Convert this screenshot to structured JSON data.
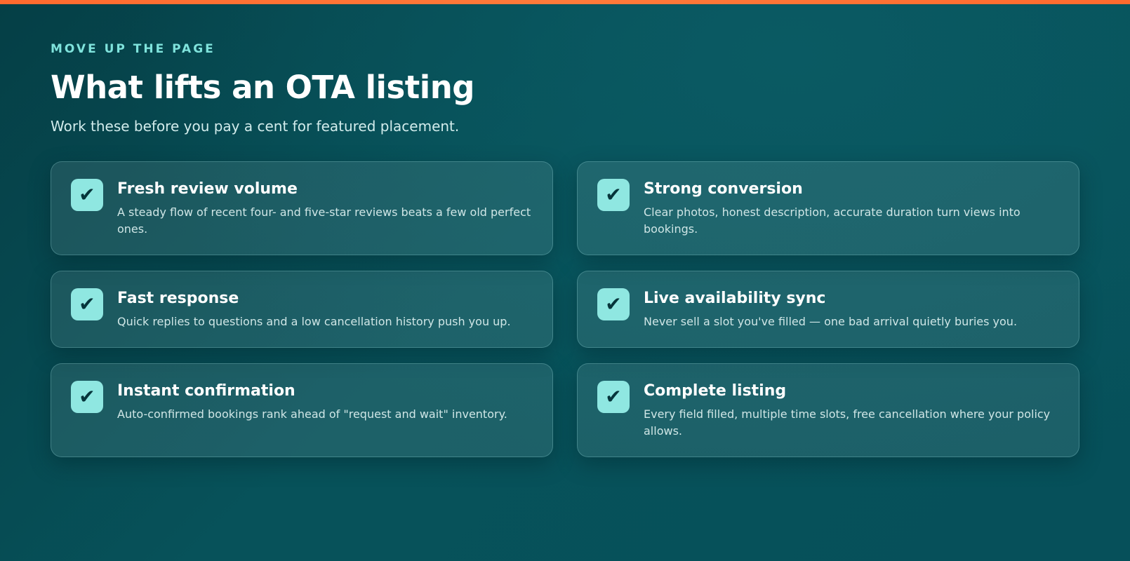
{
  "header": {
    "eyebrow": "MOVE UP THE PAGE",
    "title": "What lifts an OTA listing",
    "subtitle": "Work these before you pay a cent for featured placement."
  },
  "cards": [
    {
      "icon": "checkmark-icon",
      "glyph": "✔",
      "title": "Fresh review volume",
      "description": "A steady flow of recent four- and five-star reviews beats a few old perfect ones."
    },
    {
      "icon": "checkmark-icon",
      "glyph": "✔",
      "title": "Strong conversion",
      "description": "Clear photos, honest description, accurate duration turn views into bookings."
    },
    {
      "icon": "checkmark-icon",
      "glyph": "✔",
      "title": "Fast response",
      "description": "Quick replies to questions and a low cancellation history push you up."
    },
    {
      "icon": "checkmark-icon",
      "glyph": "✔",
      "title": "Live availability sync",
      "description": "Never sell a slot you've filled — one bad arrival quietly buries you."
    },
    {
      "icon": "checkmark-icon",
      "glyph": "✔",
      "title": "Instant confirmation",
      "description": "Auto-confirmed bookings rank ahead of \"request and wait\" inventory."
    },
    {
      "icon": "checkmark-icon",
      "glyph": "✔",
      "title": "Complete listing",
      "description": "Every field filled, multiple time slots, free cancellation where your policy allows."
    }
  ],
  "colors": {
    "accent_bar": "#ff6a2e",
    "eyebrow": "#7fe3dc",
    "check_bg": "#8fe7e1",
    "background": "#054b53"
  }
}
